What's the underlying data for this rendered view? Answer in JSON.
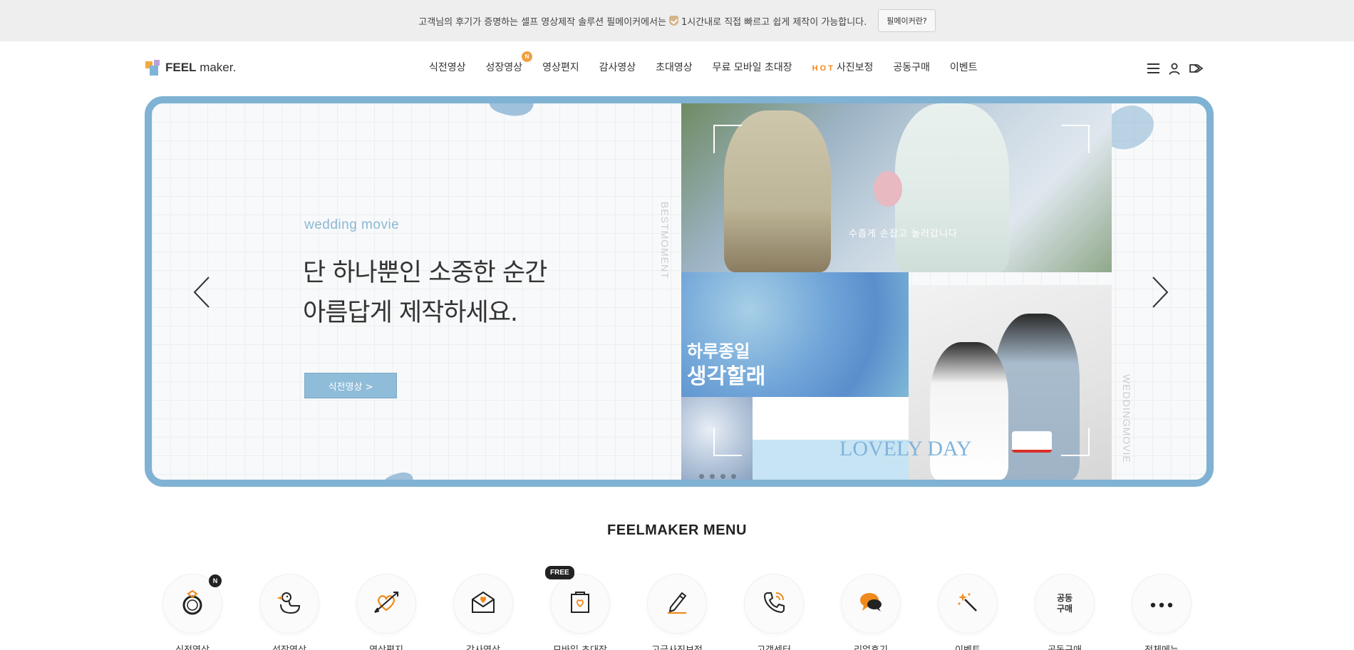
{
  "notice": {
    "text_before": "고객님의 후기가 증명하는 셀프 영상제작 솔루션 필메이커에서는",
    "text_after": "1시간내로 직접 빠르고 쉽게 제작이 가능합니다.",
    "button": "필메이커란?"
  },
  "logo": {
    "brand_bold": "FEEL",
    "brand_light": "maker."
  },
  "nav": {
    "items": [
      "식전영상",
      "성장영상",
      "영상편지",
      "감사영상",
      "초대영상",
      "무료 모바일 초대장",
      "사진보정",
      "공동구매",
      "이벤트"
    ],
    "new_badge": "N",
    "hot_label": "HOT"
  },
  "hero": {
    "subtitle": "wedding movie",
    "title_line1": "단 하나뿐인 소중한 순간",
    "title_line2": "아름답게 제작하세요.",
    "button": "식전영상 >",
    "side_text_left": "BESTMOMENT",
    "side_text_right": "WEDDINGMOVIE",
    "collage_text_small": "수줍게 손잡고 놀러갑니다",
    "collage_text_big1": "하루종일",
    "collage_text_big2": "생각할래",
    "collage_text_lovely": "LOVELY DAY",
    "slide_count": 4
  },
  "menu": {
    "title": "FEELMAKER MENU",
    "items": [
      {
        "label": "식전영상",
        "icon": "ring-icon",
        "badge": "N"
      },
      {
        "label": "성장영상",
        "icon": "duck-icon"
      },
      {
        "label": "영상편지",
        "icon": "heart-arrow-icon"
      },
      {
        "label": "감사영상",
        "icon": "envelope-heart-icon"
      },
      {
        "label": "모바일 초대장",
        "icon": "mobile-card-icon",
        "badge": "FREE"
      },
      {
        "label": "고급사진보정",
        "icon": "pencil-icon"
      },
      {
        "label": "고객센터",
        "icon": "phone-icon"
      },
      {
        "label": "리얼후기",
        "icon": "chat-icon"
      },
      {
        "label": "이벤트",
        "icon": "magic-wand-icon"
      },
      {
        "label": "공동구매",
        "icon": "group-buy-text-icon",
        "icon_text1": "공동",
        "icon_text2": "구매"
      },
      {
        "label": "전체메뉴",
        "icon": "more-icon"
      }
    ]
  },
  "colors": {
    "accent_blue": "#7fb2d3",
    "accent_orange": "#f08a1c",
    "badge_dark": "#222222"
  }
}
